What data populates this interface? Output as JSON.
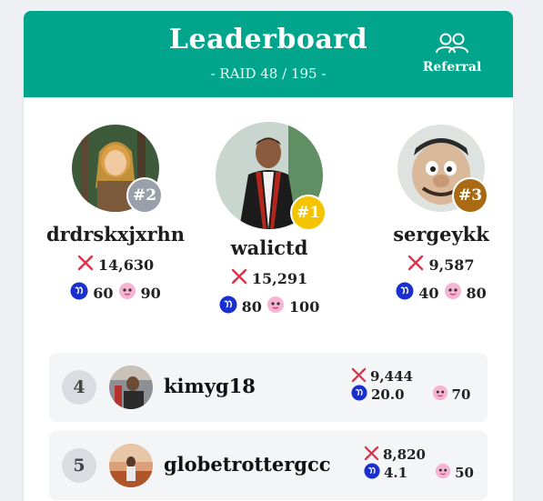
{
  "header": {
    "title": "Leaderboard",
    "subtitle": "- RAID 48 / 195 -",
    "referral_label": "Referral"
  },
  "colors": {
    "header_bg": "#00a58c",
    "rank1": "#f5c400",
    "rank2": "#9aa0aa",
    "rank3": "#a86a12"
  },
  "icons": {
    "damage": "crossed-swords-icon",
    "currency": "steem-coin-icon",
    "pet": "pink-character-icon",
    "referral": "users-icon"
  },
  "podium": [
    {
      "rank_label": "#2",
      "name": "drdrskxjxrhn",
      "damage": "14,630",
      "coins": "60",
      "pets": "90"
    },
    {
      "rank_label": "#1",
      "name": "walictd",
      "damage": "15,291",
      "coins": "80",
      "pets": "100"
    },
    {
      "rank_label": "#3",
      "name": "sergeykk",
      "damage": "9,587",
      "coins": "40",
      "pets": "80"
    }
  ],
  "rows": [
    {
      "rank": "4",
      "name": "kimyg18",
      "damage": "9,444",
      "coins": "20.0",
      "pets": "70"
    },
    {
      "rank": "5",
      "name": "globetrottergcc",
      "damage": "8,820",
      "coins": "4.1",
      "pets": "50"
    }
  ]
}
